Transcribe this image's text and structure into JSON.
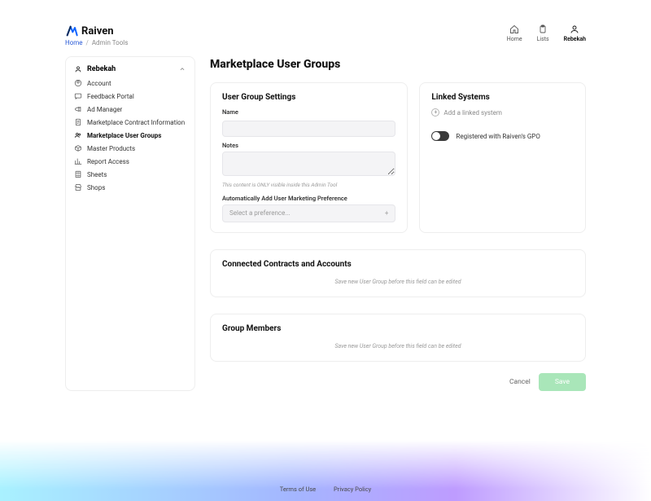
{
  "brand": {
    "name": "Raiven"
  },
  "breadcrumbs": {
    "home": "Home",
    "current": "Admin Tools"
  },
  "topnav": {
    "home": "Home",
    "lists": "Lists",
    "user": "Rebekah"
  },
  "sidebar": {
    "header": "Rebekah",
    "items": [
      {
        "icon": "user-circle-icon",
        "label": "Account"
      },
      {
        "icon": "chat-icon",
        "label": "Feedback Portal"
      },
      {
        "icon": "megaphone-icon",
        "label": "Ad Manager"
      },
      {
        "icon": "doc-icon",
        "label": "Marketplace Contract Information"
      },
      {
        "icon": "users-icon",
        "label": "Marketplace User Groups"
      },
      {
        "icon": "box-icon",
        "label": "Master Products"
      },
      {
        "icon": "chart-icon",
        "label": "Report Access"
      },
      {
        "icon": "sheet-icon",
        "label": "Sheets"
      },
      {
        "icon": "shop-icon",
        "label": "Shops"
      }
    ],
    "active_index": 4
  },
  "page": {
    "title": "Marketplace User Groups",
    "settings": {
      "heading": "User Group Settings",
      "name_label": "Name",
      "name_value": "",
      "notes_label": "Notes",
      "notes_value": "",
      "notes_hint": "This content is ONLY visible inside this Admin Tool",
      "pref_label": "Automatically Add User Marketing Preference",
      "pref_placeholder": "Select a preference..."
    },
    "linked": {
      "heading": "Linked Systems",
      "add_label": "Add a linked system",
      "gpo_label": "Registered with Raiven's GPO",
      "gpo_on": false
    },
    "contracts": {
      "heading": "Connected Contracts and Accounts",
      "empty": "Save new User Group before this field can be edited"
    },
    "members": {
      "heading": "Group Members",
      "empty": "Save new User Group before this field can be edited"
    },
    "actions": {
      "cancel": "Cancel",
      "save": "Save"
    }
  },
  "footer": {
    "terms": "Terms of Use",
    "privacy": "Privacy Policy"
  }
}
